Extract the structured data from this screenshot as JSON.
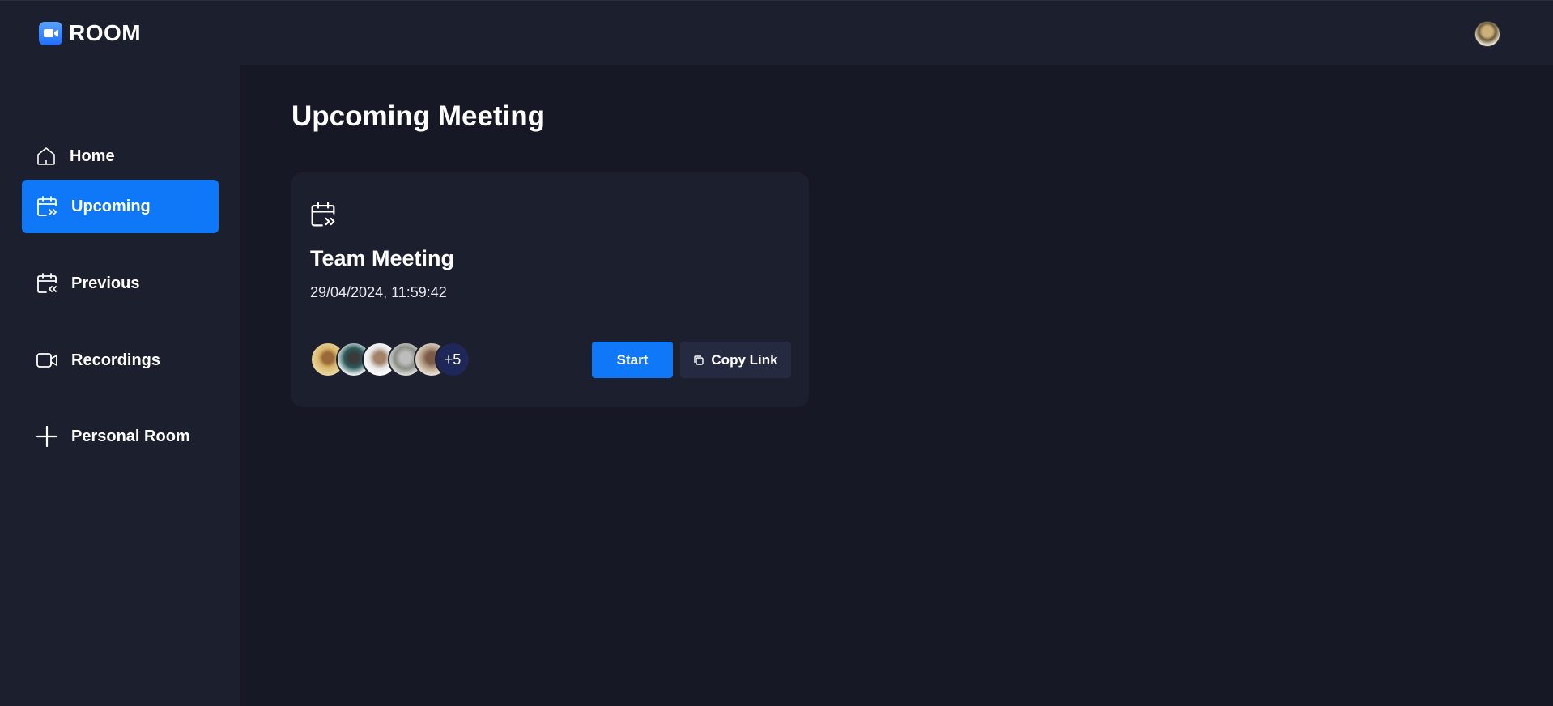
{
  "app": {
    "logo_text": "ROOM",
    "logo_icon": "video-camera-icon",
    "accent_color": "#0e78f9"
  },
  "sidebar": {
    "items": [
      {
        "label": "Home",
        "icon": "home-icon",
        "active": false
      },
      {
        "label": "Upcoming",
        "icon": "calendar-upcoming-icon",
        "active": true
      },
      {
        "label": "Previous",
        "icon": "calendar-previous-icon",
        "active": false
      },
      {
        "label": "Recordings",
        "icon": "video-icon",
        "active": false
      },
      {
        "label": "Personal Room",
        "icon": "plus-icon",
        "active": false
      }
    ]
  },
  "main": {
    "title": "Upcoming Meeting",
    "meeting": {
      "icon": "calendar-upcoming-icon",
      "title": "Team Meeting",
      "date": "29/04/2024, 11:59:42",
      "attendee_overflow": "+5",
      "start_label": "Start",
      "copy_link_label": "Copy Link"
    }
  }
}
